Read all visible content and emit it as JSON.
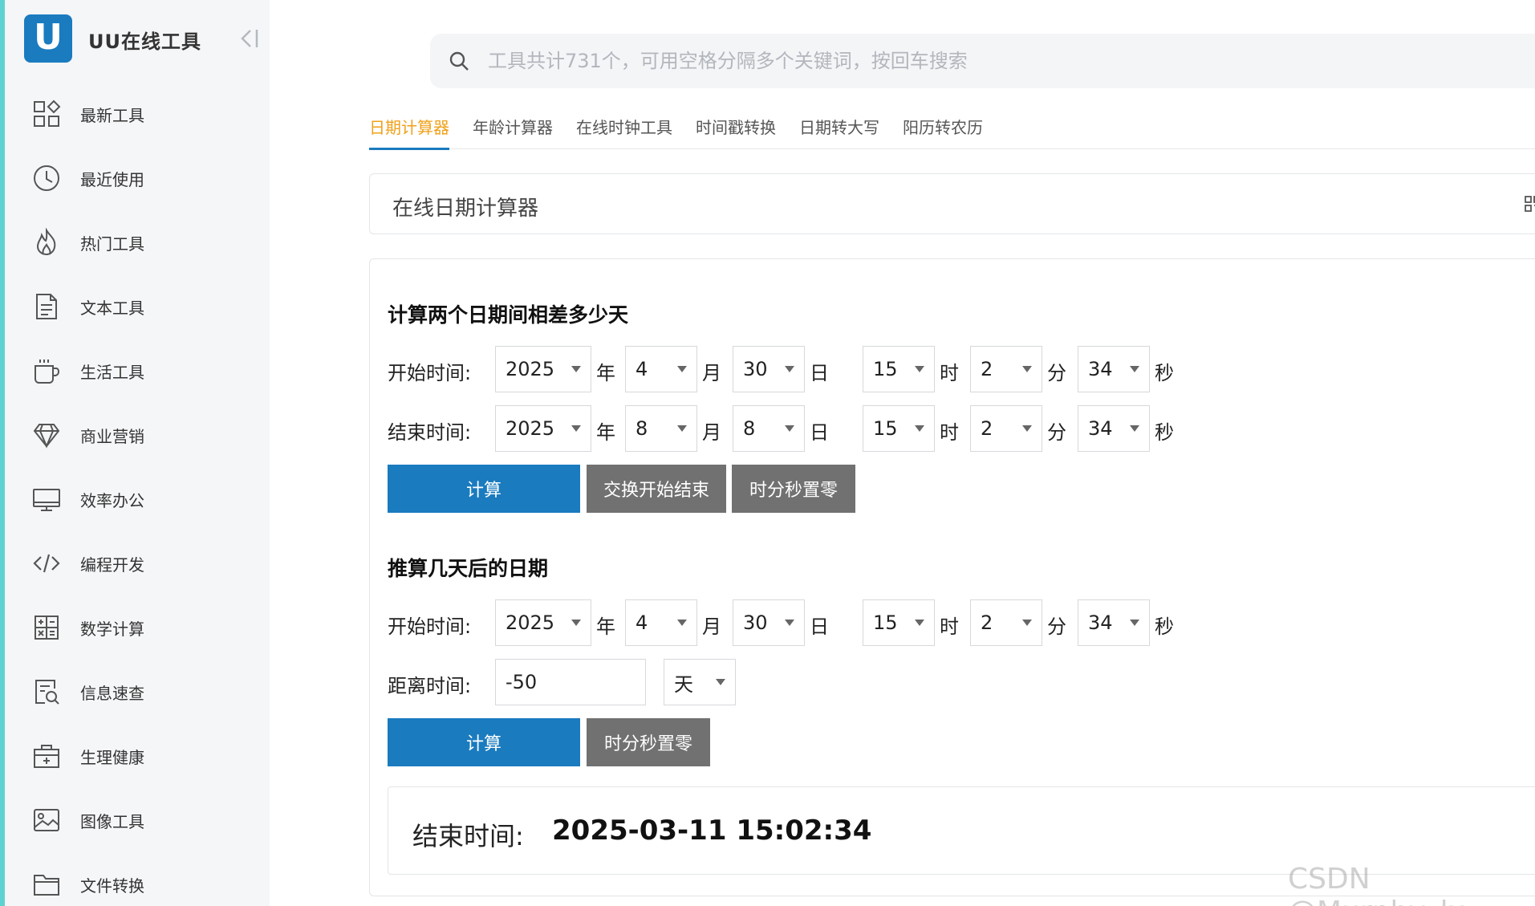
{
  "app": {
    "logo_letter": "U",
    "title": "UU在线工具"
  },
  "sidebar": {
    "items": [
      {
        "label": "最新工具",
        "icon": "apps-grid-icon"
      },
      {
        "label": "最近使用",
        "icon": "clock-icon"
      },
      {
        "label": "热门工具",
        "icon": "flame-icon"
      },
      {
        "label": "文本工具",
        "icon": "document-icon"
      },
      {
        "label": "生活工具",
        "icon": "cup-icon"
      },
      {
        "label": "商业营销",
        "icon": "diamond-icon"
      },
      {
        "label": "效率办公",
        "icon": "monitor-icon"
      },
      {
        "label": "编程开发",
        "icon": "code-icon"
      },
      {
        "label": "数学计算",
        "icon": "calculator-icon"
      },
      {
        "label": "信息速查",
        "icon": "search-doc-icon"
      },
      {
        "label": "生理健康",
        "icon": "medkit-icon"
      },
      {
        "label": "图像工具",
        "icon": "image-icon"
      },
      {
        "label": "文件转换",
        "icon": "folder-icon"
      }
    ]
  },
  "search": {
    "placeholder": "工具共计731个，可用空格分隔多个关键词，按回车搜索"
  },
  "tabs": [
    "日期计算器",
    "年龄计算器",
    "在线时钟工具",
    "时间戳转换",
    "日期转大写",
    "阳历转农历"
  ],
  "header": {
    "title": "在线日期计算器"
  },
  "diff_section": {
    "title": "计算两个日期间相差多少天",
    "start_label": "开始时间:",
    "end_label": "结束时间:",
    "start": {
      "year": "2025",
      "month": "4",
      "day": "30",
      "hour": "15",
      "minute": "2",
      "second": "34"
    },
    "end": {
      "year": "2025",
      "month": "8",
      "day": "8",
      "hour": "15",
      "minute": "2",
      "second": "34"
    },
    "buttons": {
      "calc": "计算",
      "swap": "交换开始结束",
      "zero": "时分秒置零"
    }
  },
  "units": {
    "year": "年",
    "month": "月",
    "day": "日",
    "hour": "时",
    "minute": "分",
    "second": "秒"
  },
  "offset_section": {
    "title": "推算几天后的日期",
    "start_label": "开始时间:",
    "offset_label": "距离时间:",
    "start": {
      "year": "2025",
      "month": "4",
      "day": "30",
      "hour": "15",
      "minute": "2",
      "second": "34"
    },
    "offset_value": "-50",
    "offset_unit": "天",
    "buttons": {
      "calc": "计算",
      "zero": "时分秒置零"
    }
  },
  "result": {
    "label": "结束时间:",
    "value": "2025-03-11 15:02:34"
  },
  "watermark": "CSDN @Murphy_lx",
  "colors": {
    "primary": "#1a7bbf",
    "accent_tab": "#f0a11a",
    "gray_button": "#717171",
    "strip": "#5dd3d1"
  }
}
